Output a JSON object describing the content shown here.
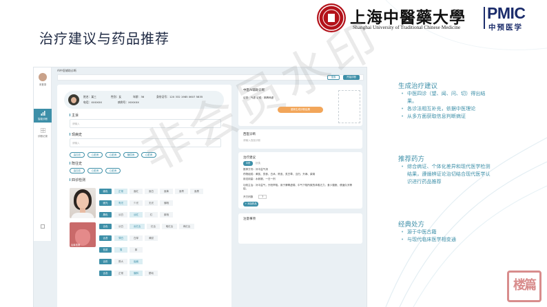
{
  "slide": {
    "title": "治疗建议与药品推荐"
  },
  "logo": {
    "university_cn": "上海中醫藥大學",
    "university_en": "Shanghai University of Traditional Chinese Medicine",
    "pmic": "PMIC",
    "pmic_cn": "中预医学"
  },
  "app": {
    "breadcrumb": "AI中医辅助诊断",
    "search_btn": "搜索",
    "action_btn": "开始诊断",
    "sidebar": {
      "user": "未登录",
      "items": [
        {
          "label": "智能诊断",
          "icon": "bar-chart-icon",
          "active": true
        },
        {
          "label": "诊断记录",
          "icon": "grid-icon",
          "active": false
        }
      ]
    },
    "patient": {
      "name": "姓名：某三",
      "gender": "性别：女",
      "age": "年龄：36",
      "id_no": "身份证号：120 332 1985 0607 5835",
      "phone": "电话：XXXXXX",
      "case_no": "病例号：XXXXXX"
    },
    "complaint_label": "主诉",
    "complaint_placeholder": "请输入",
    "history_label": "现病史",
    "history_placeholder": "请输入",
    "symptom_chips": [
      "高血压",
      "心脏病",
      "心脏病",
      "糖尿病",
      "心脏病"
    ],
    "past_label": "既往史",
    "past_chips": [
      "高血压",
      "心脏病",
      "心脏病"
    ],
    "tongue_label": "四诊检测",
    "tongue_tag": "舌象检测",
    "tongue_rows": [
      {
        "tag": "面色",
        "items": [
          "正常",
          "面红",
          "面白",
          "面黄",
          "面青",
          "面黑"
        ]
      },
      {
        "tag": "面光",
        "items": [
          "有光",
          "少光",
          "无光",
          "偏暗"
        ]
      },
      {
        "tag": "唇色",
        "items": [
          "淡白",
          "淡红",
          "红",
          "紫暗"
        ]
      },
      {
        "tag": "舌色",
        "items": [
          "淡白",
          "淡红舌",
          "红舌",
          "暗红舌",
          "绛红舌"
        ]
      },
      {
        "tag": "舌苔",
        "items": [
          "薄白",
          "白厚",
          "黄腻"
        ]
      },
      {
        "tag": "苔质",
        "items": [
          "薄",
          "厚"
        ]
      },
      {
        "tag": "舌形",
        "items": [
          "胖大",
          "齿痕"
        ]
      },
      {
        "tag": "舌态",
        "items": [
          "正常",
          "偏斜",
          "颤动"
        ]
      }
    ],
    "diagnosis_card": {
      "title": "中医AI辅助诊断",
      "row": "证型：气虚    证候：肺脾两虚",
      "btn": "重新生成诊断结果"
    },
    "tcm_card": {
      "title": "西医诊断",
      "placeholder": "请输入西医诊断"
    },
    "treatment_card": {
      "title": "治疗建议",
      "tab1": "中药",
      "tab2": "针灸",
      "line1": "推荐方剂：补中益气汤",
      "line2": "药物组成：黄芪、党参、白术、陈皮、炙甘草、当归、升麻、柴胡",
      "line3": "用法用量：水煎服，一日一剂",
      "line4": "功效主治：补中益气，升阳举陷。用于脾胃虚弱、中气下陷所致的体倦乏力、食少腹胀、便溏久泻等症。",
      "qty_label": "开方剂数",
      "qty_value": "7",
      "add_btn": "+ 添加药品"
    },
    "note_card": {
      "title": "注意事项"
    }
  },
  "sections": [
    {
      "title": "生成治疗建议",
      "items": [
        "中医四诊（望、闻、问、切）得出结果。",
        "各诊法相互补充，依据中医理论",
        "从多方面获取信息判断病证"
      ]
    },
    {
      "title": "推荐药方",
      "items": [
        "综合病证、个体化差异和现代医学检测结果，遵循辨证论治切结合现代医学认识进行药品推荐"
      ]
    },
    {
      "title": "经典处方",
      "items": [
        "源于中医古籍",
        "与现代临床医学相变通"
      ]
    }
  ],
  "watermark": "非会员水印",
  "stamp": "楼篇",
  "colors": {
    "accent": "#3d8fa8",
    "title": "#1f2a44",
    "brand_red": "#b3121a",
    "brand_navy": "#1b2c6b",
    "orange": "#f2a65a"
  }
}
